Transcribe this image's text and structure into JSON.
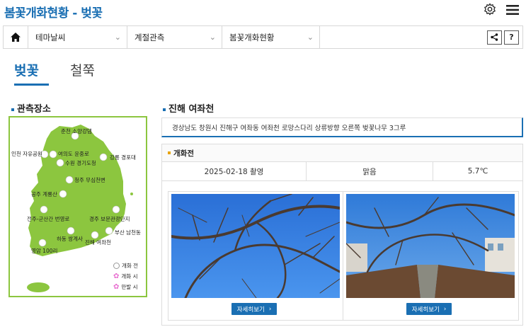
{
  "page": {
    "title": "봄꽃개화현황 - 벚꽃"
  },
  "header_icons": {
    "settings": "gear-icon",
    "menu": "hamburger-icon"
  },
  "nav": {
    "home_icon": "home-icon",
    "selects": [
      {
        "label": "테마날씨"
      },
      {
        "label": "계절관측"
      },
      {
        "label": "봄꽃개화현황"
      }
    ],
    "share_icon": "share-icon",
    "help_label": "?"
  },
  "tabs": [
    {
      "label": "벚꽃",
      "active": true
    },
    {
      "label": "철쭉",
      "active": false
    }
  ],
  "left": {
    "heading": "관측장소",
    "stations": [
      {
        "name": "춘천 소양강댐"
      },
      {
        "name": "인천 자유공원"
      },
      {
        "name": "여의도 윤중로"
      },
      {
        "name": "강릉 경포대"
      },
      {
        "name": "수원 경기도청"
      },
      {
        "name": "청주 무심천변"
      },
      {
        "name": "공주 계룡산"
      },
      {
        "name": "경주 보문관광단지"
      },
      {
        "name": "전주-군산간 번영로"
      },
      {
        "name": "부산 남천동"
      },
      {
        "name": "하동 쌍계사"
      },
      {
        "name": "진해 여좌천"
      },
      {
        "name": "영암 100리"
      }
    ],
    "legend": [
      {
        "label": "개화 전",
        "icon": "circle-icon"
      },
      {
        "label": "개화 시",
        "icon": "flower-icon",
        "color": "#e86fd0"
      },
      {
        "label": "만발 시",
        "icon": "flower-icon",
        "color": "#e86fd0"
      }
    ],
    "map_color": "#8cc63f"
  },
  "right": {
    "heading": "진해 여좌천",
    "address": "경상남도 창원시 진해구 여좌동 여좌천 로망스다리 상류방향 오른쪽 벚꽃나무 3그루",
    "status": "개화전",
    "date": "2025-02-18 촬영",
    "weather": "맑음",
    "temperature": "5.7℃",
    "photos": [
      {
        "button": "자세히보기",
        "button_icon": "chevron-right-icon"
      },
      {
        "button": "자세히보기",
        "button_icon": "chevron-right-icon"
      }
    ]
  },
  "colors": {
    "accent": "#1a6fb3",
    "map_green": "#8cc63f",
    "sky": "#2f7fd8"
  }
}
